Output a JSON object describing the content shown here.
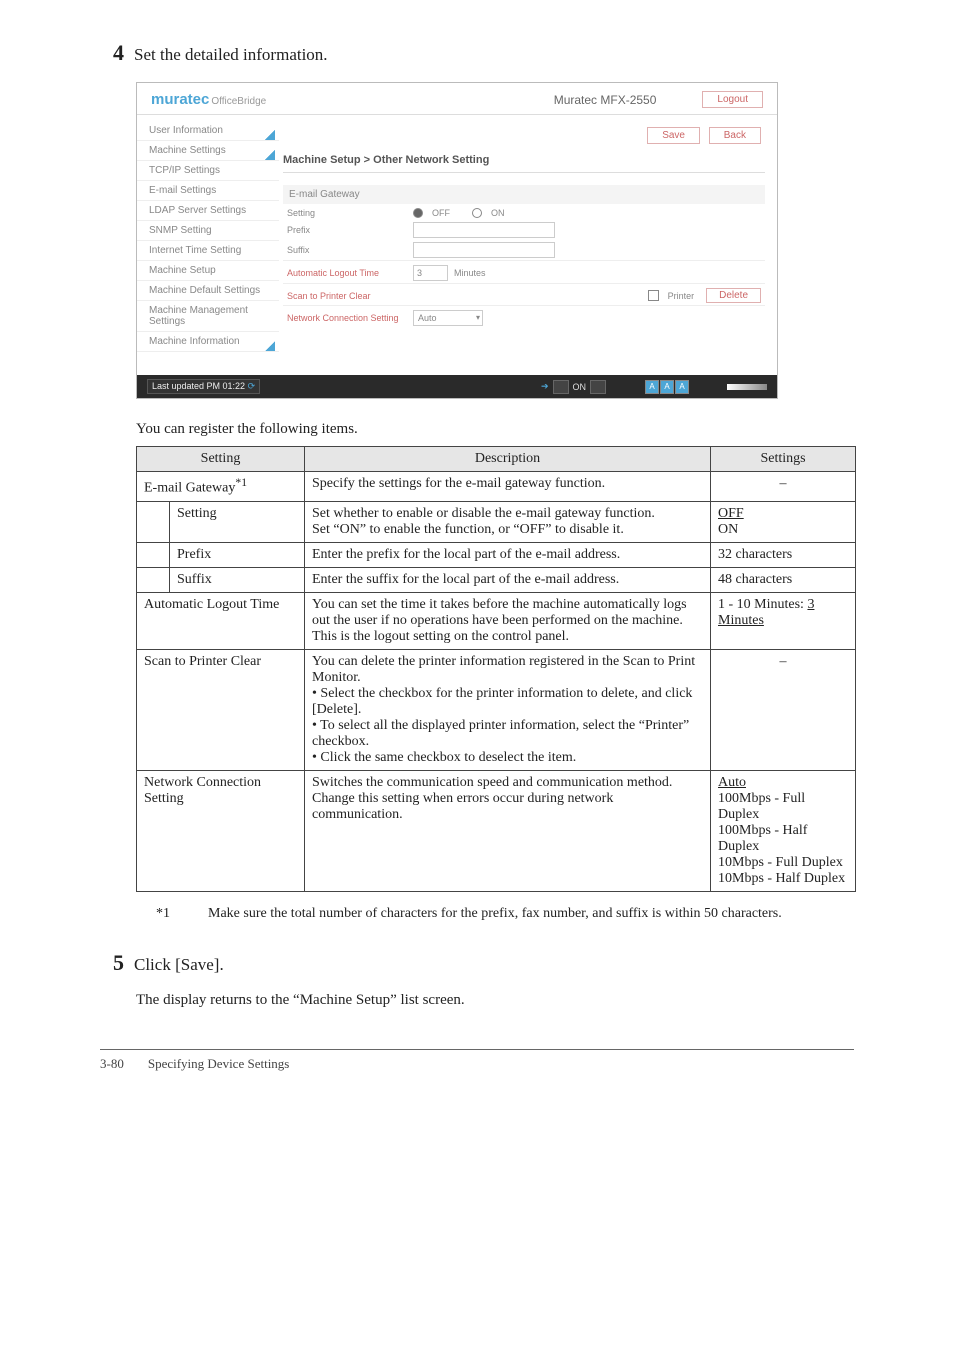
{
  "step4": {
    "num": "4",
    "text": "Set the detailed information."
  },
  "screenshot": {
    "brand": "muratec",
    "brandSub": "OfficeBridge",
    "device": "Muratec MFX-2550",
    "logoutBtn": "Logout",
    "saveBtn": "Save",
    "backBtn": "Back",
    "breadcrumb": "Machine Setup > Other Network Setting",
    "sidebar": [
      "User Information",
      "Machine Settings",
      "TCP/IP Settings",
      "E-mail Settings",
      "LDAP Server Settings",
      "SNMP Setting",
      "Internet Time Setting",
      "Machine Setup",
      "Machine Default Settings",
      "Machine Management Settings",
      "Machine Information"
    ],
    "sectionTitle": "E-mail Gateway",
    "rows": {
      "setting": {
        "label": "Setting",
        "off": "OFF",
        "on": "ON"
      },
      "prefix": "Prefix",
      "suffix": "Suffix",
      "autoLogout": {
        "label": "Automatic Logout Time",
        "value": "3",
        "unit": "Minutes"
      },
      "scanToPrinter": {
        "label": "Scan to Printer Clear",
        "chk": "Printer",
        "btn": "Delete"
      },
      "netConn": {
        "label": "Network Connection Setting",
        "value": "Auto"
      }
    },
    "status": {
      "updated": "Last updated PM 01:22",
      "on": "ON",
      "a": "A"
    }
  },
  "intro": "You can register the following items.",
  "tableHeaders": {
    "setting": "Setting",
    "desc": "Description",
    "settings": "Settings"
  },
  "rows": {
    "emailGateway": {
      "name": "E-mail Gateway",
      "sup": "*1",
      "desc": "Specify the settings for the e-mail gateway function.",
      "set": "–"
    },
    "setting": {
      "name": "Setting",
      "desc": "Set whether to enable or disable the e-mail gateway function.\nSet “ON” to enable the function, or “OFF” to disable it.",
      "set1": "OFF",
      "set2": "ON"
    },
    "prefix": {
      "name": "Prefix",
      "desc": "Enter the prefix for the local part of the e-mail address.",
      "set": "32 characters"
    },
    "suffix": {
      "name": "Suffix",
      "desc": "Enter the suffix for the local part of the e-mail address.",
      "set": "48 characters"
    },
    "autoLogout": {
      "name": "Automatic Logout Time",
      "desc": "You can set the time it takes before the machine automatically logs out the user if no operations have been performed on the machine. This is the logout setting on the control panel.",
      "set1a": "1 - 10 Minutes: ",
      "set1b": "3",
      "set2": "Minutes"
    },
    "scanToPrinter": {
      "name": "Scan to Printer Clear",
      "desc": "You can delete the printer information registered in the Scan to Print Monitor.\n• Select the checkbox for the printer information to delete, and click [Delete].\n• To select all the displayed printer information, select the “Printer” checkbox.\n• Click the same checkbox to deselect the item.",
      "set": "–"
    },
    "netConn": {
      "name": "Network Connection Setting",
      "desc": "Switches the communication speed and communication method. Change this setting when errors occur during network communication.",
      "set1": "Auto",
      "setRest": "100Mbps - Full Duplex\n100Mbps - Half Duplex\n10Mbps - Full Duplex\n10Mbps - Half Duplex"
    }
  },
  "footnote": {
    "mark": "*1",
    "text": "Make sure the total number of characters for the prefix, fax number, and suffix is within 50 characters."
  },
  "step5": {
    "num": "5",
    "text": "Click [Save]."
  },
  "post5": "The display returns to the “Machine Setup” list screen.",
  "footer": {
    "page": "3-80",
    "title": "Specifying Device Settings"
  }
}
